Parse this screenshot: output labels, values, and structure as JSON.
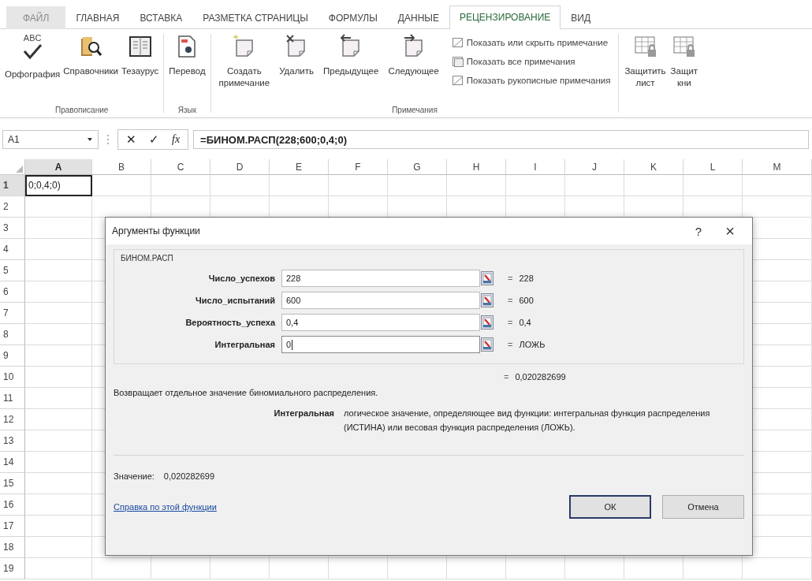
{
  "tabs": [
    {
      "label": "ФАЙЛ",
      "kind": "file",
      "selected": false
    },
    {
      "label": "ГЛАВНАЯ",
      "kind": "tab",
      "selected": false
    },
    {
      "label": "ВСТАВКА",
      "kind": "tab",
      "selected": false
    },
    {
      "label": "РАЗМЕТКА СТРАНИЦЫ",
      "kind": "tab",
      "selected": false
    },
    {
      "label": "ФОРМУЛЫ",
      "kind": "tab",
      "selected": false
    },
    {
      "label": "ДАННЫЕ",
      "kind": "tab",
      "selected": false
    },
    {
      "label": "РЕЦЕНЗИРОВАНИЕ",
      "kind": "tab",
      "selected": true
    },
    {
      "label": "ВИД",
      "kind": "tab",
      "selected": false
    }
  ],
  "ribbon": {
    "groups": [
      {
        "label": "Правописание",
        "items": [
          {
            "kind": "spelling",
            "icon_text": "ABC",
            "lines": [
              "Орфография"
            ]
          },
          {
            "kind": "research",
            "lines": [
              "Справочники"
            ]
          },
          {
            "kind": "thesaurus",
            "lines": [
              "Тезаурус"
            ]
          }
        ]
      },
      {
        "label": "Язык",
        "items": [
          {
            "kind": "translate",
            "lines": [
              "Перевод"
            ]
          }
        ]
      },
      {
        "label": "Примечания",
        "items": [
          {
            "kind": "new-comment",
            "lines": [
              "Создать",
              "примечание"
            ]
          },
          {
            "kind": "delete-comment",
            "lines": [
              "Удалить"
            ]
          },
          {
            "kind": "previous",
            "lines": [
              "Предыдущее"
            ]
          },
          {
            "kind": "next",
            "lines": [
              "Следующее"
            ]
          }
        ],
        "small_items": [
          {
            "kind": "show-hide",
            "label": "Показать или скрыть примечание"
          },
          {
            "kind": "show-all",
            "label": "Показать все примечания"
          },
          {
            "kind": "ink",
            "label": "Показать рукописные примечания"
          }
        ]
      },
      {
        "items": [
          {
            "kind": "protect-sheet",
            "lines": [
              "Защитить",
              "лист"
            ]
          },
          {
            "kind": "protect-book",
            "lines": [
              "Защит",
              "кни"
            ]
          }
        ]
      }
    ]
  },
  "formula_bar": {
    "name_box": "A1",
    "cancel": "✕",
    "enter": "✓",
    "function": "fx",
    "formula": "=БИНОМ.РАСП(228;600;0,4;0)"
  },
  "sheet": {
    "columns": [
      {
        "label": "A",
        "selected": true
      },
      {
        "label": "B",
        "selected": false
      },
      {
        "label": "C",
        "selected": false
      },
      {
        "label": "D",
        "selected": false
      },
      {
        "label": "E",
        "selected": false
      },
      {
        "label": "F",
        "selected": false
      },
      {
        "label": "G",
        "selected": false
      },
      {
        "label": "H",
        "selected": false
      },
      {
        "label": "I",
        "selected": false
      },
      {
        "label": "J",
        "selected": false
      },
      {
        "label": "K",
        "selected": false
      },
      {
        "label": "L",
        "selected": false
      },
      {
        "label": "M",
        "selected": false
      }
    ],
    "rows": [
      {
        "label": "1",
        "selected": true,
        "cells": [
          "0;0,4;0)"
        ]
      },
      {
        "label": "2",
        "selected": false
      },
      {
        "label": "3",
        "selected": false
      },
      {
        "label": "4",
        "selected": false
      },
      {
        "label": "5",
        "selected": false
      },
      {
        "label": "6",
        "selected": false
      },
      {
        "label": "7",
        "selected": false
      },
      {
        "label": "8",
        "selected": false
      },
      {
        "label": "9",
        "selected": false
      },
      {
        "label": "10",
        "selected": false
      },
      {
        "label": "11",
        "selected": false
      },
      {
        "label": "12",
        "selected": false
      },
      {
        "label": "13",
        "selected": false
      },
      {
        "label": "14",
        "selected": false
      },
      {
        "label": "15",
        "selected": false
      },
      {
        "label": "16",
        "selected": false
      },
      {
        "label": "17",
        "selected": false
      },
      {
        "label": "18",
        "selected": false
      },
      {
        "label": "19",
        "selected": false
      }
    ]
  },
  "dialog": {
    "title": "Аргументы функции",
    "help": "?",
    "close": "×",
    "function_name": "БИНОМ.РАСП",
    "arguments": [
      {
        "label": "Число_успехов",
        "value": "228",
        "equals": "=",
        "result": "228",
        "focused": false
      },
      {
        "label": "Число_испытаний",
        "value": "600",
        "equals": "=",
        "result": "600",
        "focused": false
      },
      {
        "label": "Вероятность_успеха",
        "value": "0,4",
        "equals": "=",
        "result": "0,4",
        "focused": false
      },
      {
        "label": "Интегральная",
        "value": "0",
        "equals": "=",
        "result": "ЛОЖЬ",
        "focused": true
      }
    ],
    "result_equals": "=",
    "result": "0,020282699",
    "description": "Возвращает отдельное значение биномиального распределения.",
    "argument_name": "Интегральная",
    "argument_help": "логическое значение, определяющее вид функции: интегральная функция распределения (ИСТИНА) или весовая функция распределения (ЛОЖЬ).",
    "value_label": "Значение:",
    "value": "0,020282699",
    "help_link": "Справка по этой функции",
    "buttons": [
      {
        "label": "ОК",
        "default": true
      },
      {
        "label": "Отмена",
        "default": false
      }
    ]
  }
}
